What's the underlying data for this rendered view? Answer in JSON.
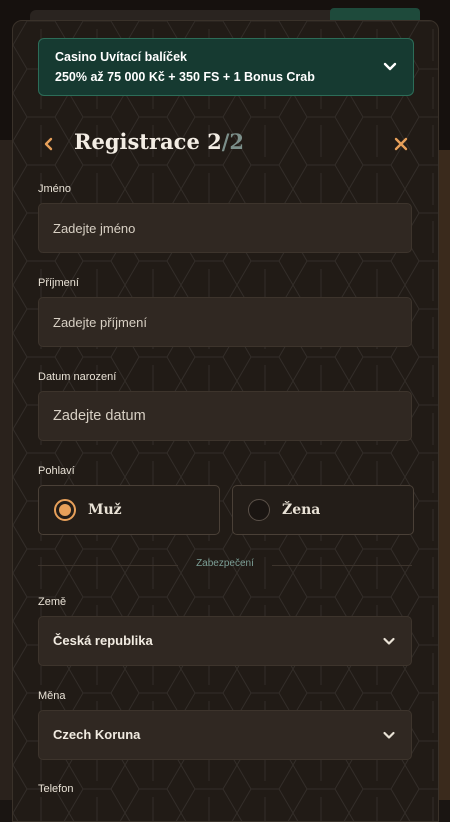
{
  "bonus": {
    "line1": "Casino Uvítací balíček",
    "line2": "250% až 75 000 Kč + 350 FS + 1 Bonus Crab"
  },
  "header": {
    "title_main": "Registrace 2",
    "title_sep": "/2"
  },
  "fields": {
    "first_name": {
      "label": "Jméno",
      "placeholder": "Zadejte jméno"
    },
    "last_name": {
      "label": "Příjmení",
      "placeholder": "Zadejte příjmení"
    },
    "birth_date": {
      "label": "Datum narození",
      "placeholder": "Zadejte datum"
    }
  },
  "gender": {
    "label": "Pohlaví",
    "options": [
      {
        "label": "Muž",
        "selected": true
      },
      {
        "label": "Žena",
        "selected": false
      }
    ]
  },
  "security": {
    "divider_label": "Zabezpečení"
  },
  "country": {
    "label": "Země",
    "value": "Česká republika"
  },
  "currency": {
    "label": "Měna",
    "value": "Czech Koruna"
  },
  "phone": {
    "label": "Telefon"
  },
  "colors": {
    "accent": "#e7a05a",
    "bonus_bg": "#163a31",
    "panel_bg": "#211b16",
    "field_bg": "#302822"
  },
  "icons": {
    "back": "chevron-left-icon",
    "close": "close-icon",
    "dropdown": "chevron-down-icon"
  }
}
